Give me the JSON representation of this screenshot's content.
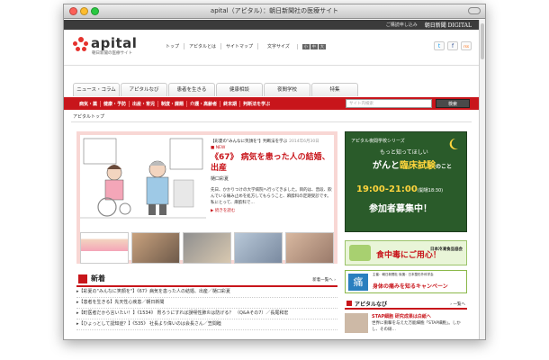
{
  "window": {
    "title": "apital（アピタル）：朝日新聞社の医療サイト"
  },
  "topbar": {
    "subscribe": "ご購読申し込み",
    "brand": "朝日新聞",
    "digital": "DIGITAL"
  },
  "header": {
    "logo": "apital",
    "logo_sub": "朝日新聞の医療サイト",
    "nav": [
      "トップ",
      "アピタルとは",
      "サイトマップ",
      "文字サイズ"
    ],
    "font_sizes": [
      "小",
      "中",
      "大"
    ],
    "social": [
      "t",
      "f",
      "rss"
    ]
  },
  "tabs": [
    "ニュース・コラム",
    "アピタルなび",
    "患者を生きる",
    "健康相談",
    "夜間学校",
    "特集"
  ],
  "categories": [
    "病気・薬",
    "健康・予防",
    "出産・育児",
    "制度・課題",
    "介護・高齢者",
    "終末期",
    "判断法を学ぶ"
  ],
  "search": {
    "placeholder": "サイト内検索",
    "button": "検索"
  },
  "breadcrumb": "アピタルトップ",
  "feature": {
    "header": "【彩夏の\"みんなに笑顔を\"】判断法を学ぶ",
    "date": "2014年6月30日",
    "new": "NEW",
    "title": "《67》 病気を患った人の結婚、出産",
    "author": "樋口彩夏",
    "body": "先日、かかりつけの大学病院へ行ってきました。目的は、普段、飲んでいる痛み止めを処方してもらうこと、麻酔科の定期受診です。私にとって、麻酔科で…",
    "more": "続きを読む"
  },
  "ad1": {
    "series": "アピタル夜間学校シリーズ",
    "line1": "もっと知ってほしい",
    "line2_a": "がんと",
    "line2_b": "臨床試験",
    "line2_c": "のこと",
    "time": "19:00-21:00",
    "time_note": "(開場18:30)",
    "recruit": "参加者募集中！"
  },
  "ad2": {
    "text": "食中毒にご用心！",
    "org": "日本冷凍食品協会"
  },
  "ad3": {
    "small": "主催：朝日新聞社 後援：日本整形外科学会",
    "text": "身体の痛みを知るキャンペーン",
    "icon": "痛"
  },
  "news": {
    "title": "新着",
    "more": "新着一覧へ",
    "items": [
      {
        "tag": "【彩夏の\"みんなに笑顔を\"】",
        "text": "《67》病気を患った人の結婚、出産／樋口彩夏"
      },
      {
        "tag": "【患者を生きる】",
        "text": "先天性心疾患／朝日新聞"
      },
      {
        "tag": "【町医者だから言いたい！】",
        "text": "《1534》 胃ろうにすれば誤嚥性肺炎は防げる？ （Q&Aその7）／長尾和宏"
      },
      {
        "tag": "【ひょっとして認知症？】",
        "text": "《535》 社長より偉いのは会長さん／笠間睦"
      }
    ]
  },
  "side": {
    "title": "アピタルなび",
    "more": "一覧へ",
    "items": [
      {
        "a": "STAP細胞 研究成果は白紙へ",
        "b": "世界に衝撃を与えた万能細胞「STAP細胞」。しかし、その研…"
      }
    ]
  }
}
